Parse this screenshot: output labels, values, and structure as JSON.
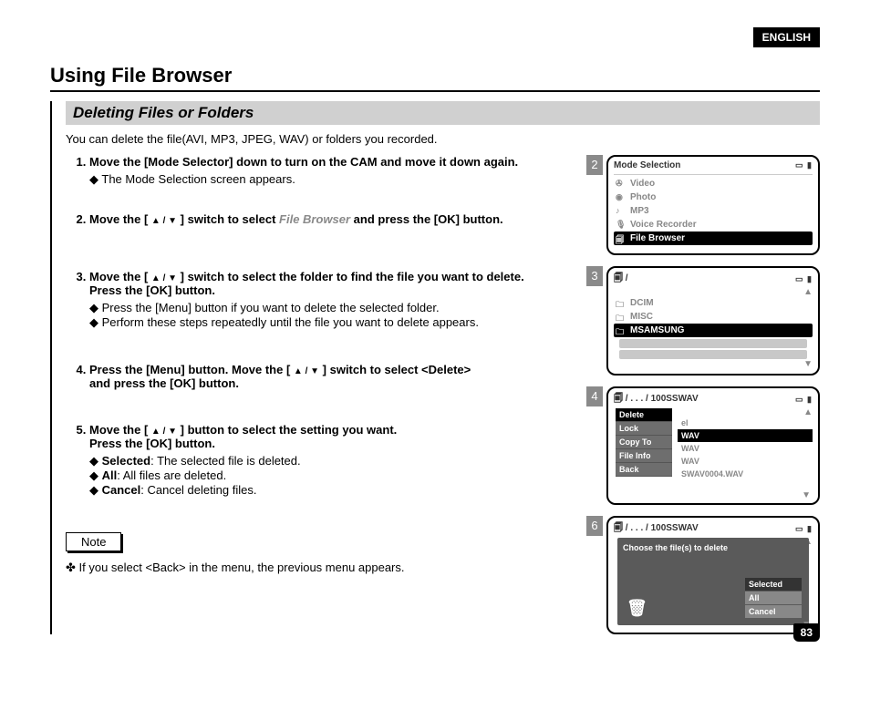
{
  "lang_badge": "ENGLISH",
  "title": "Using File Browser",
  "subtitle": "Deleting Files or Folders",
  "intro": "You can delete the file(AVI, MP3, JPEG, WAV) or folders you recorded.",
  "steps": {
    "s1": {
      "lead": "Move the [Mode Selector] down to turn on the CAM and move it down again.",
      "sub1": "The Mode Selection screen appears."
    },
    "s2": {
      "lead_a": "Move the [ ",
      "lead_b": " ] switch to select ",
      "grey": "File Browser",
      "lead_c": " and press the [OK] button."
    },
    "s3": {
      "lead_a": "Move the [ ",
      "lead_b": " ] switch to select the folder to find the file you want to delete.",
      "line2": "Press the [OK] button.",
      "sub1": "Press the [Menu] button if you want to delete the selected folder.",
      "sub2": "Perform these steps repeatedly until the file you want to delete appears."
    },
    "s4": {
      "lead_a": "Press the [Menu] button. Move the [ ",
      "lead_b": " ] switch to select <Delete>",
      "line2": "and press the [OK] button."
    },
    "s5": {
      "lead_a": "Move the [ ",
      "lead_b": " ] button to select the setting you want.",
      "line2": "Press the [OK] button.",
      "opt1_term": "Selected",
      "opt1_desc": ": The selected file is deleted.",
      "opt2_term": "All",
      "opt2_desc": ": All files are deleted.",
      "opt3_term": "Cancel",
      "opt3_desc": ": Cancel deleting files."
    }
  },
  "note_label": "Note",
  "note_text": "If you select <Back> in the menu, the previous menu appears.",
  "page_number": "83",
  "screens": {
    "scr2": {
      "num": "2",
      "header": "Mode Selection",
      "items": [
        "Video",
        "Photo",
        "MP3",
        "Voice Recorder",
        "File Browser"
      ]
    },
    "scr3": {
      "num": "3",
      "path": "/",
      "items": [
        "DCIM",
        "MISC",
        "MSAMSUNG"
      ]
    },
    "scr4": {
      "num": "4",
      "path": "/ . . . / 100SSWAV",
      "menu": [
        "Delete",
        "Lock",
        "Copy To",
        "File Info",
        "Back"
      ],
      "files_partial": "el",
      "files": [
        "WAV",
        "WAV",
        "WAV",
        "SWAV0004.WAV"
      ]
    },
    "scr6": {
      "num": "6",
      "path": "/ . . . / 100SSWAV",
      "popup_title": "Choose the file(s) to delete",
      "options": [
        "Selected",
        "All",
        "Cancel"
      ]
    }
  }
}
